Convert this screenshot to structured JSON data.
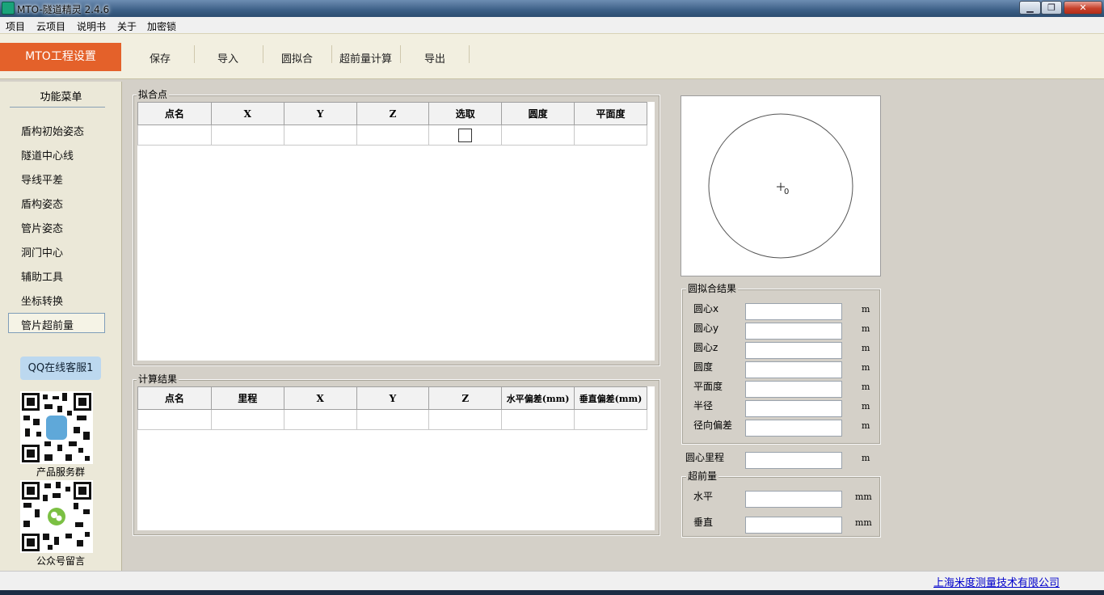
{
  "window": {
    "title": "MTO-隧道精灵 2.4.6",
    "min": "▁",
    "max": "❐",
    "close": "✕"
  },
  "menu": [
    "项目",
    "云项目",
    "说明书",
    "关于",
    "加密锁"
  ],
  "toolbar": {
    "tab": "MTO工程设置",
    "buttons": [
      "保存",
      "导入",
      "圆拟合",
      "超前量计算",
      "导出"
    ]
  },
  "sidebar": {
    "title": "功能菜单",
    "items": [
      "盾构初始姿态",
      "隧道中心线",
      "导线平差",
      "盾构姿态",
      "管片姿态",
      "洞门中心",
      "辅助工具",
      "坐标转换",
      "管片超前量"
    ],
    "active_index": 8,
    "qq_button": "QQ在线客服1",
    "qr1_caption": "产品服务群",
    "qr2_caption": "公众号留言"
  },
  "fit_points": {
    "label": "拟合点",
    "columns": [
      "点名",
      "X",
      "Y",
      "Z",
      "选取",
      "圆度",
      "平面度"
    ]
  },
  "calc_results": {
    "label": "计算结果",
    "columns": [
      "点名",
      "里程",
      "X",
      "Y",
      "Z",
      "水平偏差(mm)",
      "垂直偏差(mm)"
    ]
  },
  "preview": {
    "center_label": "0"
  },
  "circle_fit": {
    "label": "圆拟合结果",
    "rows": [
      {
        "label": "圆心x",
        "unit": "m"
      },
      {
        "label": "圆心y",
        "unit": "m"
      },
      {
        "label": "圆心z",
        "unit": "m"
      },
      {
        "label": "圆度",
        "unit": "m"
      },
      {
        "label": "平面度",
        "unit": "m"
      },
      {
        "label": "半径",
        "unit": "m"
      },
      {
        "label": "径向偏差",
        "unit": "m"
      }
    ]
  },
  "center_mileage": {
    "label": "圆心里程",
    "unit": "m"
  },
  "advance": {
    "label": "超前量",
    "rows": [
      {
        "label": "水平",
        "unit": "mm"
      },
      {
        "label": "垂直",
        "unit": "mm"
      }
    ]
  },
  "status": {
    "company": "上海米度测量技术有限公司"
  },
  "colors": {
    "accent": "#e4612a",
    "link": "#0000cc",
    "panel": "#d4d0c8"
  }
}
